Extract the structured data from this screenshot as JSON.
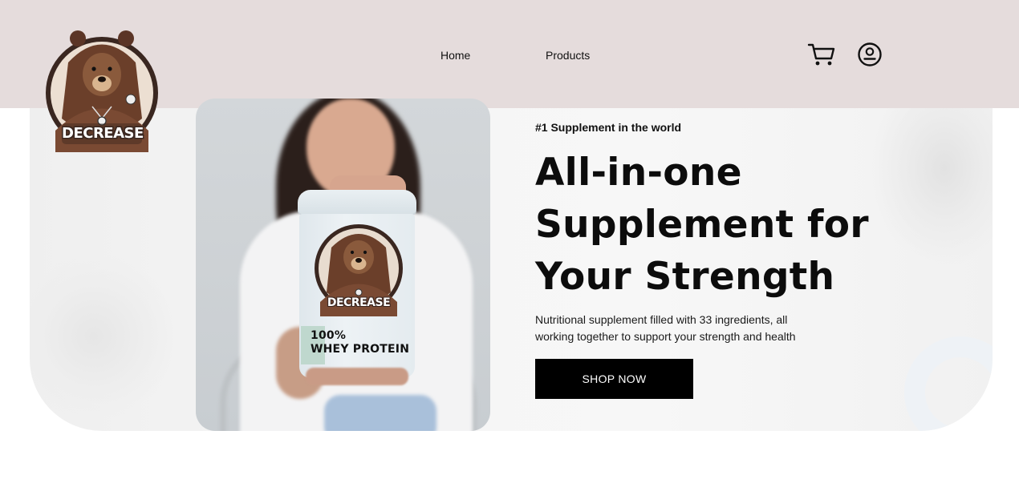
{
  "brand": {
    "name": "DECREASE",
    "logo_icon": "bear-hoodie-logo"
  },
  "nav": {
    "items": [
      {
        "label": "Home"
      },
      {
        "label": "Products"
      }
    ]
  },
  "header_actions": {
    "cart_icon": "cart-icon",
    "account_icon": "account-icon"
  },
  "hero": {
    "eyebrow": "#1 Supplement in the world",
    "headline_line_1": "All-in-one",
    "headline_line_2": "Supplement for",
    "headline_line_3": "Your Strength",
    "description": "Nutritional supplement filled with 33 ingredients, all working together to support your strength and health",
    "cta_label": "SHOP NOW"
  },
  "product_image": {
    "jar_brand": "DECREASE",
    "jar_line_1": "100%",
    "jar_line_2": "WHEY PROTEIN"
  },
  "colors": {
    "header_bg": "#e5dcdc",
    "cta_bg": "#000000",
    "cta_text": "#ffffff",
    "hero_bg": "#f4f4f4"
  }
}
